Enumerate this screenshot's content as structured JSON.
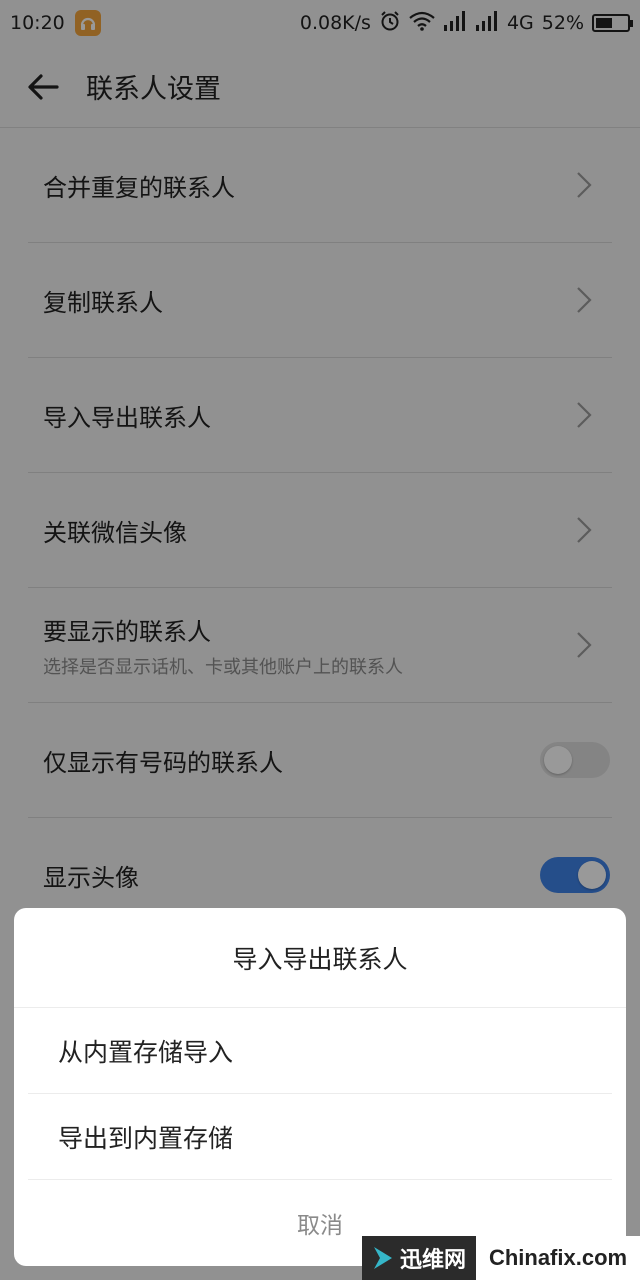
{
  "status_bar": {
    "time": "10:20",
    "net_speed": "0.08K/s",
    "network": "4G",
    "battery": "52%",
    "battery_level": 0.52,
    "icons": [
      "app-notification-icon",
      "alarm-icon",
      "wifi-icon",
      "signal-icon",
      "signal-icon",
      "battery-icon"
    ]
  },
  "header": {
    "title": "联系人设置",
    "back_icon": "back-arrow-icon"
  },
  "settings": {
    "items": [
      {
        "label": "合并重复的联系人",
        "icon": "chevron-right-icon"
      },
      {
        "label": "复制联系人",
        "icon": "chevron-right-icon"
      },
      {
        "label": "导入导出联系人",
        "icon": "chevron-right-icon"
      },
      {
        "label": "关联微信头像",
        "icon": "chevron-right-icon"
      },
      {
        "label": "要显示的联系人",
        "sub": "选择是否显示话机、卡或其他账户上的联系人",
        "icon": "chevron-right-icon"
      },
      {
        "label": "仅显示有号码的联系人",
        "toggle": false
      },
      {
        "label": "显示头像",
        "toggle": true
      }
    ]
  },
  "dialog": {
    "title": "导入导出联系人",
    "options": [
      "从内置存储导入",
      "导出到内置存储"
    ],
    "cancel": "取消"
  },
  "watermark": {
    "left": "迅维网",
    "right": "Chinafix.com"
  },
  "colors": {
    "toggle_on": "#3f82e6",
    "toggle_off": "#dcdcdc",
    "app_badge": "#f2a33c"
  }
}
